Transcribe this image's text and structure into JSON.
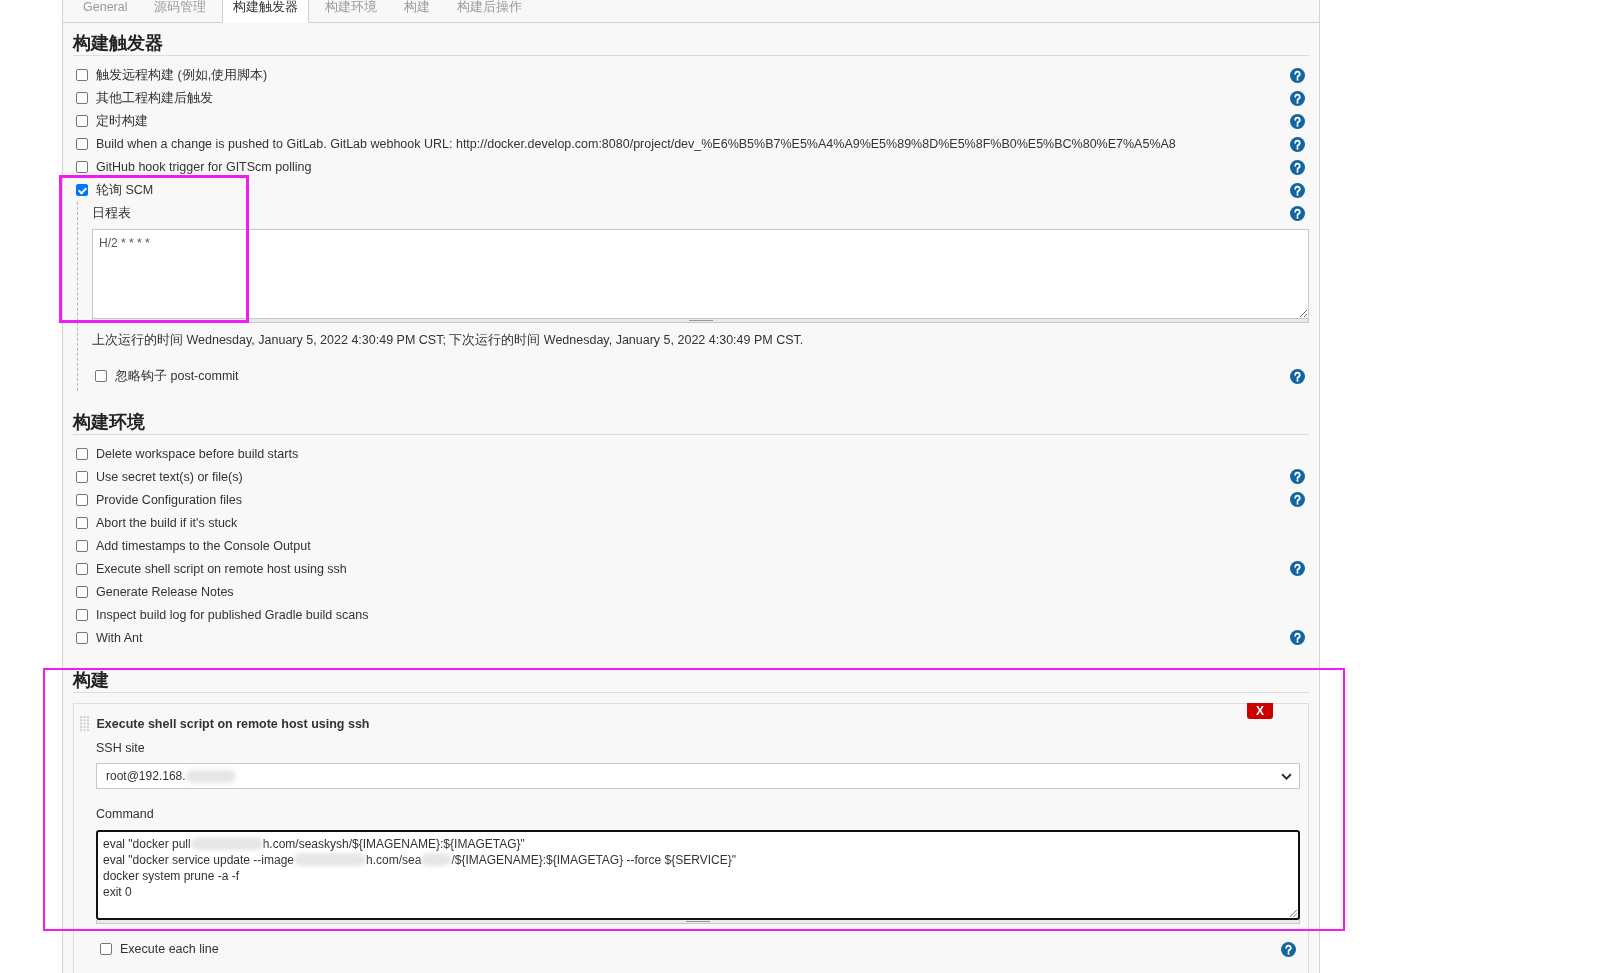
{
  "tabs": [
    {
      "label": "General",
      "selected": false
    },
    {
      "label": "源码管理",
      "selected": false
    },
    {
      "label": "构建触发器",
      "selected": true
    },
    {
      "label": "构建环境",
      "selected": false
    },
    {
      "label": "构建",
      "selected": false
    },
    {
      "label": "构建后操作",
      "selected": false
    }
  ],
  "sections": [
    {
      "kind": "checklist",
      "title": "构建触发器",
      "items": [
        {
          "label": "触发远程构建 (例如,使用脚本)",
          "checked": false,
          "help": true
        },
        {
          "label": "其他工程构建后触发",
          "checked": false,
          "help": true
        },
        {
          "label": "定时构建",
          "checked": false,
          "help": true
        },
        {
          "label": "Build when a change is pushed to GitLab. GitLab webhook URL: http://docker.develop.com:8080/project/dev_%E6%B5%B7%E5%A4%A9%E5%89%8D%E5%8F%B0%E5%BC%80%E7%A5%A8",
          "checked": false,
          "help": true
        },
        {
          "label": "GitHub hook trigger for GITScm polling",
          "checked": false,
          "help": true
        },
        {
          "label": "轮询 SCM",
          "checked": true,
          "help": true,
          "options": {
            "schedule": {
              "label": "日程表",
              "help": true,
              "value": "H/2 * * * *"
            },
            "run_info": "上次运行的时间 Wednesday, January 5, 2022 4:30:49 PM CST; 下次运行的时间 Wednesday, January 5, 2022 4:30:49 PM CST.",
            "ignore_post_commit": {
              "label": "忽略钩子 post-commit",
              "checked": false,
              "help": true
            }
          }
        }
      ]
    },
    {
      "kind": "checklist",
      "title": "构建环境",
      "items": [
        {
          "label": "Delete workspace before build starts",
          "checked": false
        },
        {
          "label": "Use secret text(s) or file(s)",
          "checked": false,
          "help": true
        },
        {
          "label": "Provide Configuration files",
          "checked": false,
          "help": true
        },
        {
          "label": "Abort the build if it's stuck",
          "checked": false
        },
        {
          "label": "Add timestamps to the Console Output",
          "checked": false
        },
        {
          "label": "Execute shell script on remote host using ssh",
          "checked": false,
          "help": true
        },
        {
          "label": "Generate Release Notes",
          "checked": false
        },
        {
          "label": "Inspect build log for published Gradle build scans",
          "checked": false
        },
        {
          "label": "With Ant",
          "checked": false,
          "help": true
        }
      ]
    },
    {
      "kind": "steps",
      "title": "构建",
      "steps": [
        {
          "title": "Execute shell script on remote host using ssh",
          "delete_label": "X",
          "ssh_site": {
            "label": "SSH site",
            "value": [
              {
                "kind": "text",
                "text": "root@192.168."
              },
              {
                "kind": "redacted"
              }
            ]
          },
          "command": {
            "label": "Command",
            "lines": [
              {
                "segments": [
                  {
                    "kind": "text",
                    "text": "eval \"docker pull"
                  },
                  {
                    "kind": "redacted"
                  },
                  {
                    "kind": "text",
                    "text": "h.com/seaskysh/${IMAGENAME}:${IMAGETAG}\""
                  }
                ]
              },
              {
                "segments": [
                  {
                    "kind": "text",
                    "text": "eval \"docker service update --image"
                  },
                  {
                    "kind": "redacted"
                  },
                  {
                    "kind": "text",
                    "text": "h.com/sea"
                  },
                  {
                    "kind": "redacted"
                  },
                  {
                    "kind": "text",
                    "text": "/${IMAGENAME}:${IMAGETAG} --force ${SERVICE}\""
                  }
                ]
              },
              {
                "segments": [
                  {
                    "kind": "text",
                    "text": "docker system prune -a -f"
                  }
                ]
              },
              {
                "segments": [
                  {
                    "kind": "text",
                    "text": "exit 0"
                  }
                ]
              }
            ]
          },
          "execute_each_line": {
            "label": "Execute each line",
            "checked": false,
            "help": true
          }
        }
      ]
    }
  ]
}
